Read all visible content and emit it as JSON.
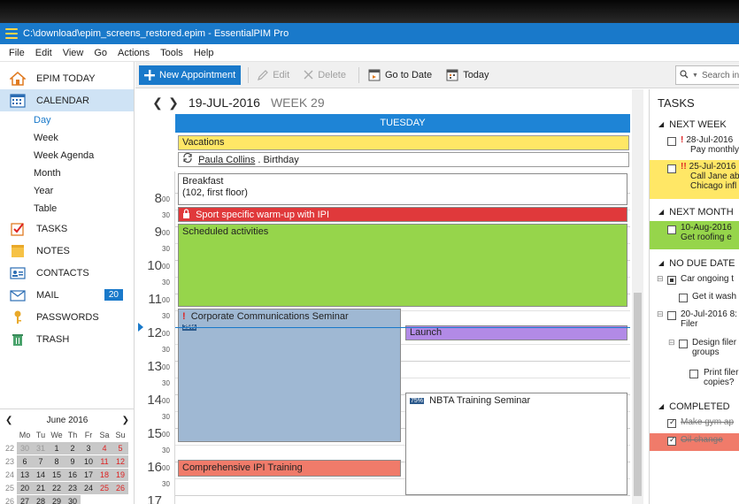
{
  "window": {
    "title": "C:\\download\\epim_screens_restored.epim - EssentialPIM Pro"
  },
  "menu": [
    "File",
    "Edit",
    "View",
    "Go",
    "Actions",
    "Tools",
    "Help"
  ],
  "sidebar": {
    "items": [
      {
        "label": "EPIM TODAY",
        "icon": "home-icon"
      },
      {
        "label": "CALENDAR",
        "icon": "calendar-icon",
        "active": true
      },
      {
        "label": "TASKS",
        "icon": "tasks-icon"
      },
      {
        "label": "NOTES",
        "icon": "notes-icon"
      },
      {
        "label": "CONTACTS",
        "icon": "contacts-icon"
      },
      {
        "label": "MAIL",
        "icon": "mail-icon",
        "badge": "20"
      },
      {
        "label": "PASSWORDS",
        "icon": "key-icon"
      },
      {
        "label": "TRASH",
        "icon": "trash-icon"
      }
    ],
    "calendar_views": [
      "Day",
      "Week",
      "Week Agenda",
      "Month",
      "Year",
      "Table"
    ],
    "active_view": "Day"
  },
  "mini_calendar": {
    "month_label": "June  2016",
    "day_headers": [
      "Mo",
      "Tu",
      "We",
      "Th",
      "Fr",
      "Sa",
      "Su"
    ],
    "weeks": [
      {
        "wk": "22",
        "days": [
          "30",
          "31",
          "1",
          "2",
          "3",
          "4",
          "5"
        ]
      },
      {
        "wk": "23",
        "days": [
          "6",
          "7",
          "8",
          "9",
          "10",
          "11",
          "12"
        ]
      },
      {
        "wk": "24",
        "days": [
          "13",
          "14",
          "15",
          "16",
          "17",
          "18",
          "19"
        ]
      },
      {
        "wk": "25",
        "days": [
          "20",
          "21",
          "22",
          "23",
          "24",
          "25",
          "26"
        ]
      },
      {
        "wk": "26",
        "days": [
          "27",
          "28",
          "29",
          "30",
          "",
          "",
          ""
        ]
      }
    ]
  },
  "toolbar": {
    "new_appointment": "New Appointment",
    "edit": "Edit",
    "delete": "Delete",
    "go_to_date": "Go to Date",
    "today": "Today",
    "search_placeholder": "Search in"
  },
  "calendar": {
    "date": "19-JUL-2016",
    "week": "WEEK 29",
    "day_name": "TUESDAY",
    "all_day": [
      {
        "text": "Vacations",
        "color": "#ffe766"
      },
      {
        "person": "Paula Collins",
        "suffix": ". Birthday",
        "color": "#ffffff"
      }
    ],
    "hours": [
      "8",
      "9",
      "10",
      "11",
      "12",
      "13",
      "14",
      "15",
      "16",
      "17"
    ],
    "half_label": "30",
    "events": {
      "breakfast": {
        "title": "Breakfast",
        "subtitle": "(102, first floor)",
        "color": "#ffffff"
      },
      "warmup": {
        "title": "Sport specific warm-up with IPI",
        "color": "#e0393b"
      },
      "scheduled": {
        "title": "Scheduled activities",
        "color": "#96d54b"
      },
      "seminar": {
        "title": "Corporate Communications Seminar",
        "pct": "25%",
        "color": "#9fb8d3"
      },
      "launch": {
        "title": "Launch",
        "color": "#b28ae6"
      },
      "nbta": {
        "title": "NBTA Training Seminar",
        "pct": "75%",
        "color": "#ffffff"
      },
      "ipi": {
        "title": "Comprehensive IPI Training",
        "color": "#f07b6a"
      }
    }
  },
  "tasks": {
    "title": "TASKS",
    "groups": {
      "next_week": "NEXT WEEK",
      "next_month": "NEXT MONTH",
      "no_due": "NO DUE DATE",
      "completed": "COMPLETED"
    },
    "items": {
      "t1_date": "28-Jul-2016",
      "t1_text": "Pay monthly",
      "t2_date": "25-Jul-2016",
      "t2_text1": "Call Jane ab",
      "t2_text2": "Chicago infl",
      "t3_date": "10-Aug-2016",
      "t3_text": "Get roofing e",
      "t4_text": "Car ongoing t",
      "t5_text": "Get it wash",
      "t6_text1": "20-Jul-2016 8:",
      "t6_text2": "Filer",
      "t7_text1": "Design filer",
      "t7_text2": "groups",
      "t8_text1": "Print filer",
      "t8_text2": "copies?",
      "c1_text": "Make gym ap",
      "c2_text": "Oil change"
    },
    "colors": {
      "yellow": "#ffe766",
      "green": "#96d54b",
      "red": "#f07b6a"
    }
  }
}
